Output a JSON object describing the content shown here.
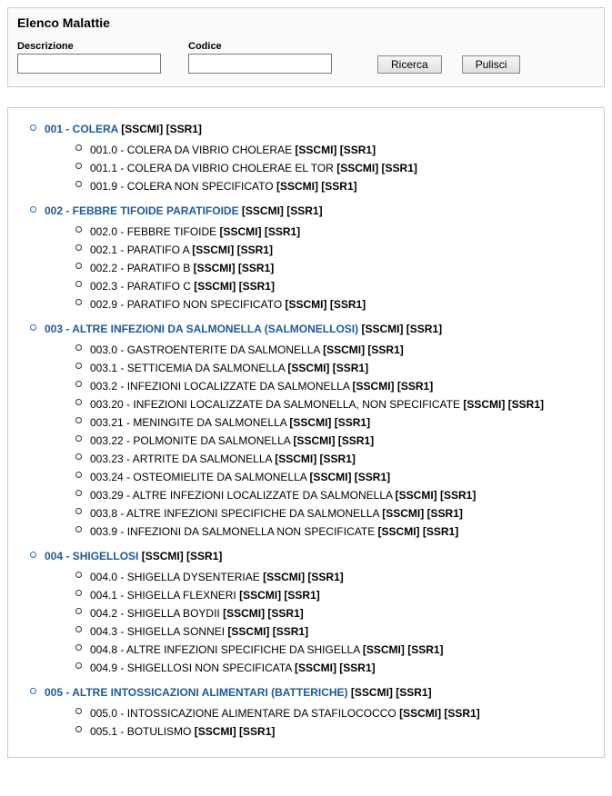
{
  "panel": {
    "title": "Elenco Malattie",
    "descrizione_label": "Descrizione",
    "codice_label": "Codice",
    "descrizione_value": "",
    "codice_value": "",
    "ricerca_label": "Ricerca",
    "pulisci_label": "Pulisci"
  },
  "tags_suffix": " [SSCMI] [SSR1]",
  "categories": [
    {
      "code": "001",
      "title": "001 - COLERA",
      "items": [
        "001.0 - COLERA DA VIBRIO CHOLERAE",
        "001.1 - COLERA DA VIBRIO CHOLERAE EL TOR",
        "001.9 - COLERA NON SPECIFICATO"
      ]
    },
    {
      "code": "002",
      "title": "002 - FEBBRE TIFOIDE PARATIFOIDE",
      "items": [
        "002.0 - FEBBRE TIFOIDE",
        "002.1 - PARATIFO A",
        "002.2 - PARATIFO B",
        "002.3 - PARATIFO C",
        "002.9 - PARATIFO NON SPECIFICATO"
      ]
    },
    {
      "code": "003",
      "title": "003 - ALTRE INFEZIONI DA SALMONELLA (SALMONELLOSI)",
      "items": [
        "003.0 - GASTROENTERITE DA SALMONELLA",
        "003.1 - SETTICEMIA DA SALMONELLA",
        "003.2 - INFEZIONI LOCALIZZATE DA SALMONELLA",
        "003.20 - INFEZIONI LOCALIZZATE DA SALMONELLA, NON SPECIFICATE",
        "003.21 - MENINGITE DA SALMONELLA",
        "003.22 - POLMONITE DA SALMONELLA",
        "003.23 - ARTRITE DA SALMONELLA",
        "003.24 - OSTEOMIELITE DA SALMONELLA",
        "003.29 - ALTRE INFEZIONI LOCALIZZATE DA SALMONELLA",
        "003.8 - ALTRE INFEZIONI SPECIFICHE DA SALMONELLA",
        "003.9 - INFEZIONI DA SALMONELLA NON SPECIFICATE"
      ]
    },
    {
      "code": "004",
      "title": "004 - SHIGELLOSI",
      "items": [
        "004.0 - SHIGELLA DYSENTERIAE",
        "004.1 - SHIGELLA FLEXNERI",
        "004.2 - SHIGELLA BOYDII",
        "004.3 - SHIGELLA SONNEI",
        "004.8 - ALTRE INFEZIONI SPECIFICHE DA SHIGELLA",
        "004.9 - SHIGELLOSI NON SPECIFICATA"
      ]
    },
    {
      "code": "005",
      "title": "005 - ALTRE INTOSSICAZIONI ALIMENTARI (BATTERICHE)",
      "items": [
        "005.0 - INTOSSICAZIONE ALIMENTARE DA STAFILOCOCCO",
        "005.1 - BOTULISMO"
      ]
    }
  ]
}
